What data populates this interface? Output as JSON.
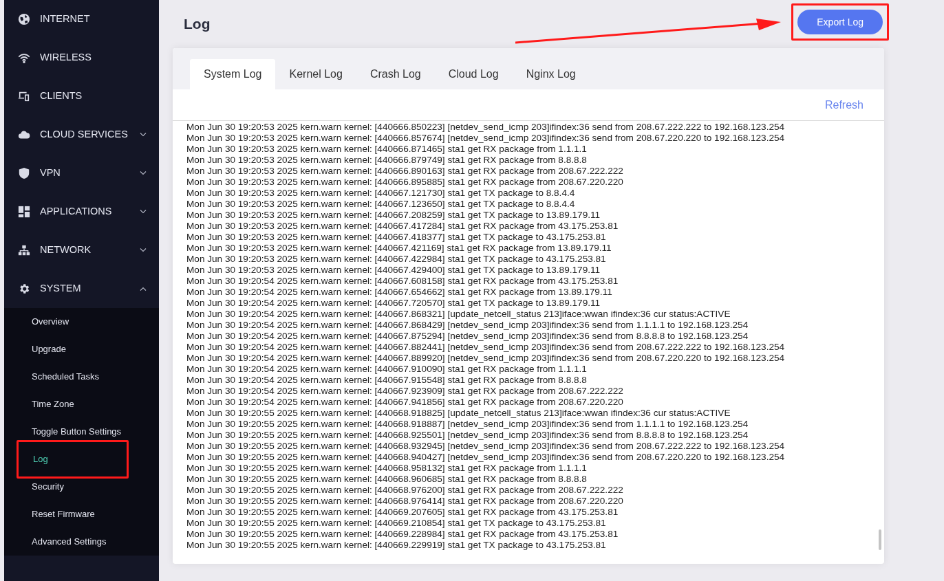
{
  "sidebar": {
    "items": [
      {
        "label": "INTERNET"
      },
      {
        "label": "WIRELESS"
      },
      {
        "label": "CLIENTS"
      },
      {
        "label": "CLOUD SERVICES",
        "expanded": false
      },
      {
        "label": "VPN",
        "expanded": false
      },
      {
        "label": "APPLICATIONS",
        "expanded": false
      },
      {
        "label": "NETWORK",
        "expanded": false
      },
      {
        "label": "SYSTEM",
        "expanded": true,
        "children": [
          {
            "label": "Overview",
            "selected": false,
            "annotated": false
          },
          {
            "label": "Upgrade",
            "selected": false,
            "annotated": false
          },
          {
            "label": "Scheduled Tasks",
            "selected": false,
            "annotated": false
          },
          {
            "label": "Time Zone",
            "selected": false,
            "annotated": false
          },
          {
            "label": "Toggle Button Settings",
            "selected": false,
            "annotated": false
          },
          {
            "label": "Log",
            "selected": true,
            "annotated": true
          },
          {
            "label": "Security",
            "selected": false,
            "annotated": false
          },
          {
            "label": "Reset Firmware",
            "selected": false,
            "annotated": false
          },
          {
            "label": "Advanced Settings",
            "selected": false,
            "annotated": false
          }
        ]
      }
    ]
  },
  "page": {
    "title": "Log",
    "export_button": {
      "label": "Export Log",
      "annotated": true
    }
  },
  "tabs": [
    {
      "label": "System Log",
      "selected": true
    },
    {
      "label": "Kernel Log",
      "selected": false
    },
    {
      "label": "Crash Log",
      "selected": false
    },
    {
      "label": "Cloud Log",
      "selected": false
    },
    {
      "label": "Nginx Log",
      "selected": false
    }
  ],
  "refresh": "Refresh",
  "log_lines": [
    "Mon Jun 30 19:20:53 2025 kern.warn kernel: [440666.850223] [netdev_send_icmp 203]ifindex:36 send from 208.67.222.222 to 192.168.123.254",
    "Mon Jun 30 19:20:53 2025 kern.warn kernel: [440666.857674] [netdev_send_icmp 203]ifindex:36 send from 208.67.220.220 to 192.168.123.254",
    "Mon Jun 30 19:20:53 2025 kern.warn kernel: [440666.871465] sta1 get RX package from 1.1.1.1",
    "Mon Jun 30 19:20:53 2025 kern.warn kernel: [440666.879749] sta1 get RX package from 8.8.8.8",
    "Mon Jun 30 19:20:53 2025 kern.warn kernel: [440666.890163] sta1 get RX package from 208.67.222.222",
    "Mon Jun 30 19:20:53 2025 kern.warn kernel: [440666.895885] sta1 get RX package from 208.67.220.220",
    "Mon Jun 30 19:20:53 2025 kern.warn kernel: [440667.121730] sta1 get TX package to 8.8.4.4",
    "Mon Jun 30 19:20:53 2025 kern.warn kernel: [440667.123650] sta1 get TX package to 8.8.4.4",
    "Mon Jun 30 19:20:53 2025 kern.warn kernel: [440667.208259] sta1 get TX package to 13.89.179.11",
    "Mon Jun 30 19:20:53 2025 kern.warn kernel: [440667.417284] sta1 get RX package from 43.175.253.81",
    "Mon Jun 30 19:20:53 2025 kern.warn kernel: [440667.418377] sta1 get TX package to 43.175.253.81",
    "Mon Jun 30 19:20:53 2025 kern.warn kernel: [440667.421169] sta1 get RX package from 13.89.179.11",
    "Mon Jun 30 19:20:53 2025 kern.warn kernel: [440667.422984] sta1 get TX package to 43.175.253.81",
    "Mon Jun 30 19:20:53 2025 kern.warn kernel: [440667.429400] sta1 get TX package to 13.89.179.11",
    "Mon Jun 30 19:20:54 2025 kern.warn kernel: [440667.608158] sta1 get RX package from 43.175.253.81",
    "Mon Jun 30 19:20:54 2025 kern.warn kernel: [440667.654662] sta1 get RX package from 13.89.179.11",
    "Mon Jun 30 19:20:54 2025 kern.warn kernel: [440667.720570] sta1 get TX package to 13.89.179.11",
    "Mon Jun 30 19:20:54 2025 kern.warn kernel: [440667.868321] [update_netcell_status 213]iface:wwan ifindex:36 cur status:ACTIVE",
    "Mon Jun 30 19:20:54 2025 kern.warn kernel: [440667.868429] [netdev_send_icmp 203]ifindex:36 send from 1.1.1.1 to 192.168.123.254",
    "Mon Jun 30 19:20:54 2025 kern.warn kernel: [440667.875294] [netdev_send_icmp 203]ifindex:36 send from 8.8.8.8 to 192.168.123.254",
    "Mon Jun 30 19:20:54 2025 kern.warn kernel: [440667.882441] [netdev_send_icmp 203]ifindex:36 send from 208.67.222.222 to 192.168.123.254",
    "Mon Jun 30 19:20:54 2025 kern.warn kernel: [440667.889920] [netdev_send_icmp 203]ifindex:36 send from 208.67.220.220 to 192.168.123.254",
    "Mon Jun 30 19:20:54 2025 kern.warn kernel: [440667.910090] sta1 get RX package from 1.1.1.1",
    "Mon Jun 30 19:20:54 2025 kern.warn kernel: [440667.915548] sta1 get RX package from 8.8.8.8",
    "Mon Jun 30 19:20:54 2025 kern.warn kernel: [440667.923909] sta1 get RX package from 208.67.222.222",
    "Mon Jun 30 19:20:54 2025 kern.warn kernel: [440667.941856] sta1 get RX package from 208.67.220.220",
    "Mon Jun 30 19:20:55 2025 kern.warn kernel: [440668.918825] [update_netcell_status 213]iface:wwan ifindex:36 cur status:ACTIVE",
    "Mon Jun 30 19:20:55 2025 kern.warn kernel: [440668.918887] [netdev_send_icmp 203]ifindex:36 send from 1.1.1.1 to 192.168.123.254",
    "Mon Jun 30 19:20:55 2025 kern.warn kernel: [440668.925501] [netdev_send_icmp 203]ifindex:36 send from 8.8.8.8 to 192.168.123.254",
    "Mon Jun 30 19:20:55 2025 kern.warn kernel: [440668.932945] [netdev_send_icmp 203]ifindex:36 send from 208.67.222.222 to 192.168.123.254",
    "Mon Jun 30 19:20:55 2025 kern.warn kernel: [440668.940427] [netdev_send_icmp 203]ifindex:36 send from 208.67.220.220 to 192.168.123.254",
    "Mon Jun 30 19:20:55 2025 kern.warn kernel: [440668.958132] sta1 get RX package from 1.1.1.1",
    "Mon Jun 30 19:20:55 2025 kern.warn kernel: [440668.960685] sta1 get RX package from 8.8.8.8",
    "Mon Jun 30 19:20:55 2025 kern.warn kernel: [440668.976200] sta1 get RX package from 208.67.222.222",
    "Mon Jun 30 19:20:55 2025 kern.warn kernel: [440668.976414] sta1 get RX package from 208.67.220.220",
    "Mon Jun 30 19:20:55 2025 kern.warn kernel: [440669.207605] sta1 get RX package from 43.175.253.81",
    "Mon Jun 30 19:20:55 2025 kern.warn kernel: [440669.210854] sta1 get TX package to 43.175.253.81",
    "Mon Jun 30 19:20:55 2025 kern.warn kernel: [440669.228984] sta1 get RX package from 43.175.253.81",
    "Mon Jun 30 19:20:55 2025 kern.warn kernel: [440669.229919] sta1 get TX package to 43.175.253.81"
  ]
}
